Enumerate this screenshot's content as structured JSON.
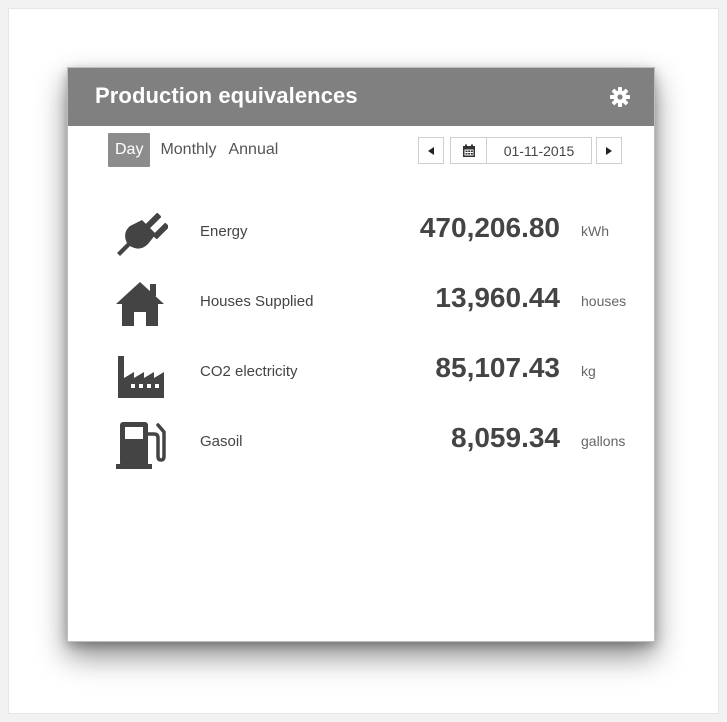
{
  "widget": {
    "title": "Production equivalences",
    "settings_icon": "gear-icon"
  },
  "period_tabs": [
    {
      "label": "Day",
      "active": true
    },
    {
      "label": "Monthly",
      "active": false
    },
    {
      "label": "Annual",
      "active": false
    }
  ],
  "date_nav": {
    "prev_icon": "triangle-left-icon",
    "calendar_icon": "calendar-icon",
    "date_value": "01-11-2015",
    "next_icon": "triangle-right-icon"
  },
  "rows": [
    {
      "icon": "plug-icon",
      "label": "Energy",
      "value": "470,206.80",
      "unit": "kWh"
    },
    {
      "icon": "house-icon",
      "label": "Houses Supplied",
      "value": "13,960.44",
      "unit": "houses"
    },
    {
      "icon": "factory-icon",
      "label": "CO2 electricity",
      "value": "85,107.43",
      "unit": "kg"
    },
    {
      "icon": "fuel-pump-icon",
      "label": "Gasoil",
      "value": "8,059.34",
      "unit": "gallons"
    }
  ],
  "colors": {
    "header_bg": "#808080",
    "icon": "#444444",
    "active_tab_bg": "#8c8c8c"
  }
}
